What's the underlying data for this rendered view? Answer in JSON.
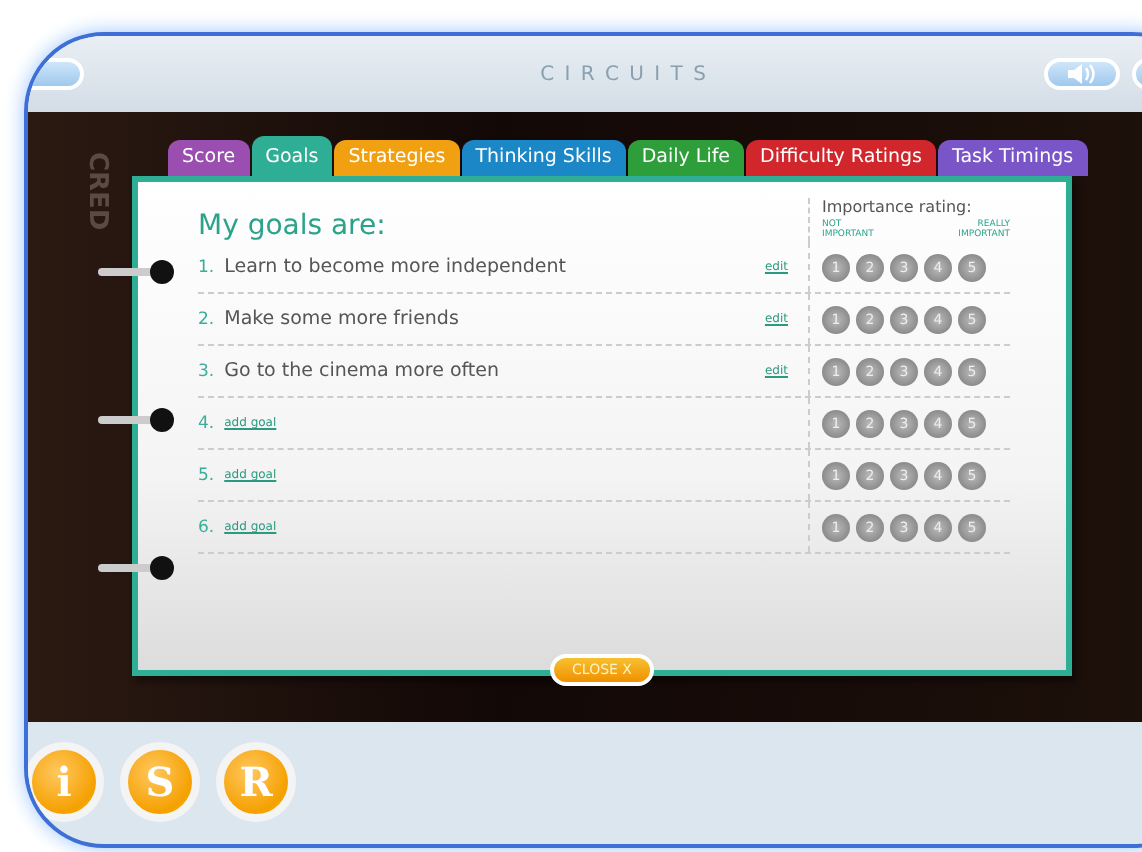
{
  "window": {
    "title": "C I R C U I T S"
  },
  "background": {
    "side_label": "CRED"
  },
  "tabs": [
    {
      "label": "Score",
      "selected": false,
      "color": "#9a4fb0"
    },
    {
      "label": "Goals",
      "selected": true,
      "color": "#2fae96"
    },
    {
      "label": "Strategies",
      "selected": false,
      "color": "#f0a010"
    },
    {
      "label": "Thinking Skills",
      "selected": false,
      "color": "#1b87c6"
    },
    {
      "label": "Daily Life",
      "selected": false,
      "color": "#2e9e3a"
    },
    {
      "label": "Difficulty Ratings",
      "selected": false,
      "color": "#d0262c"
    },
    {
      "label": "Task Timings",
      "selected": false,
      "color": "#7a55c8"
    }
  ],
  "heading": "My goals are:",
  "rating_header": {
    "title": "Importance rating:",
    "low": "NOT IMPORTANT",
    "high": "REALLY IMPORTANT"
  },
  "goals": [
    {
      "number": "1.",
      "kind": "goal",
      "text": "Learn to become more independent",
      "action": "edit",
      "ratings": [
        "1",
        "2",
        "3",
        "4",
        "5"
      ]
    },
    {
      "number": "2.",
      "kind": "goal",
      "text": "Make some more friends",
      "action": "edit",
      "ratings": [
        "1",
        "2",
        "3",
        "4",
        "5"
      ]
    },
    {
      "number": "3.",
      "kind": "goal",
      "text": "Go to the cinema more often",
      "action": "edit",
      "ratings": [
        "1",
        "2",
        "3",
        "4",
        "5"
      ]
    },
    {
      "number": "4.",
      "kind": "add",
      "text": "add goal",
      "ratings": [
        "1",
        "2",
        "3",
        "4",
        "5"
      ]
    },
    {
      "number": "5.",
      "kind": "add",
      "text": "add goal",
      "ratings": [
        "1",
        "2",
        "3",
        "4",
        "5"
      ]
    },
    {
      "number": "6.",
      "kind": "add",
      "text": "add goal",
      "ratings": [
        "1",
        "2",
        "3",
        "4",
        "5"
      ]
    }
  ],
  "close_button": "CLOSE X",
  "footer_buttons": [
    "i",
    "S",
    "R"
  ]
}
